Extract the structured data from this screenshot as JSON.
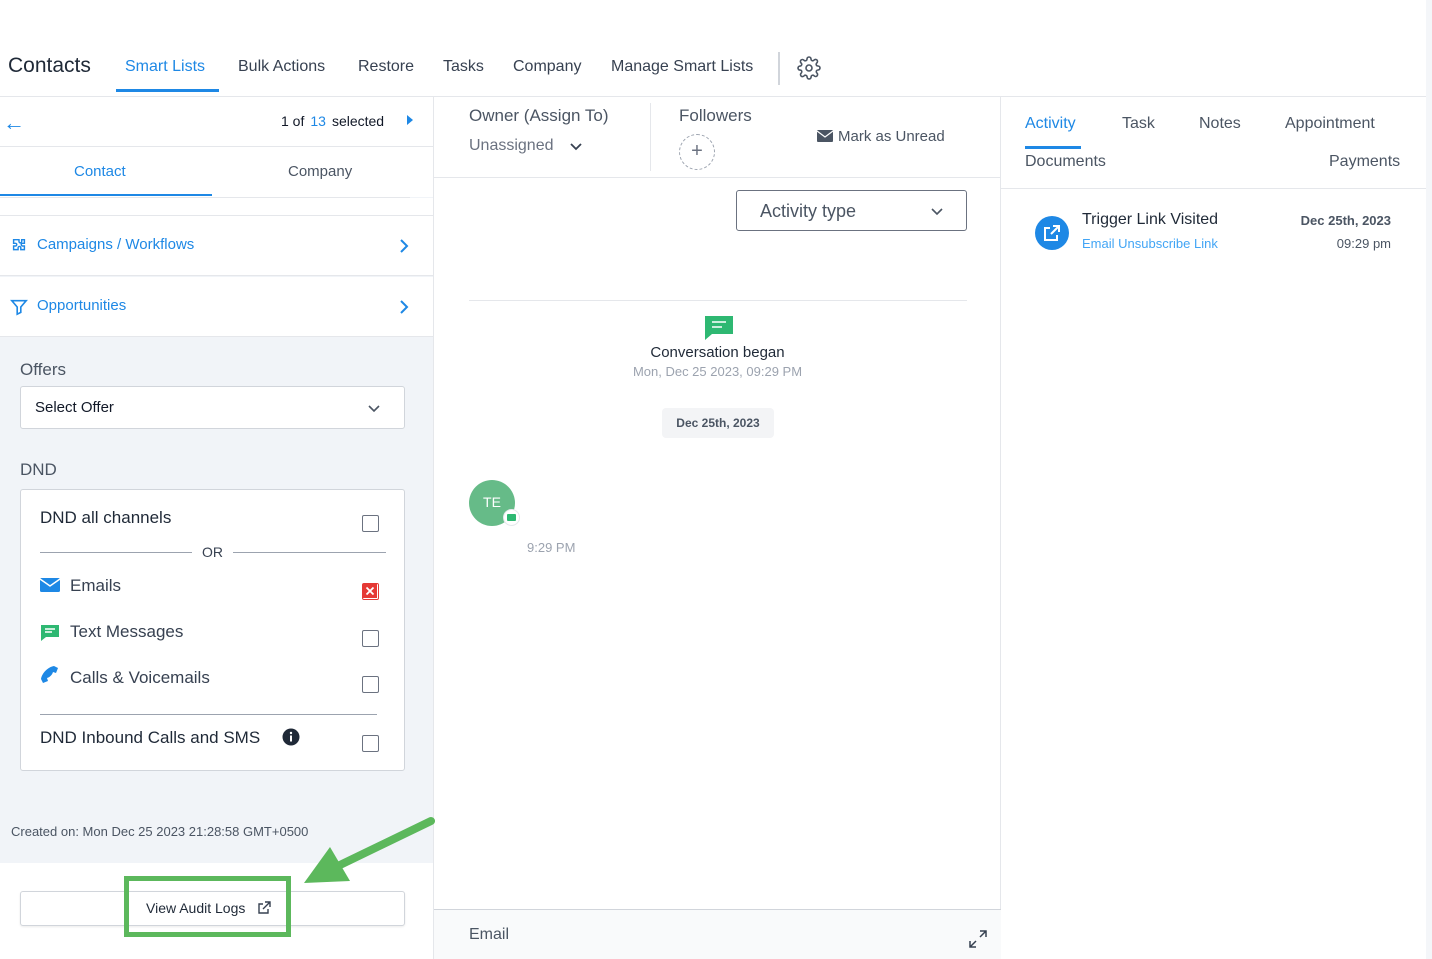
{
  "topnav": {
    "brand": "Contacts",
    "items": [
      {
        "label": "Smart Lists",
        "active": true
      },
      {
        "label": "Bulk Actions",
        "active": false
      },
      {
        "label": "Restore",
        "active": false
      },
      {
        "label": "Tasks",
        "active": false
      },
      {
        "label": "Company",
        "active": false
      },
      {
        "label": "Manage Smart Lists",
        "active": false
      }
    ]
  },
  "left": {
    "counter": {
      "prefix": "1 of",
      "total": "13",
      "suffix": "selected"
    },
    "tabs": {
      "contact": "Contact",
      "company": "Company"
    },
    "rows": {
      "campaigns": "Campaigns / Workflows",
      "opportunities": "Opportunities"
    },
    "offers": {
      "label": "Offers",
      "selected": "Select Offer"
    },
    "dnd": {
      "label": "DND",
      "all_channels": "DND all channels",
      "or_text": "OR",
      "channels": [
        {
          "label": "Emails",
          "checked": true
        },
        {
          "label": "Text Messages",
          "checked": false
        },
        {
          "label": "Calls & Voicemails",
          "checked": false
        }
      ],
      "inbound": "DND Inbound Calls and SMS"
    },
    "created": "Created on: Mon Dec 25 2023 21:28:58 GMT+0500",
    "audit_button": "View Audit Logs"
  },
  "mid": {
    "owner_label": "Owner (Assign To)",
    "owner_value": "Unassigned",
    "followers_label": "Followers",
    "mark_unread": "Mark as Unread",
    "activity_type": "Activity type",
    "conversation_title": "Conversation began",
    "conversation_time": "Mon, Dec 25 2023, 09:29 PM",
    "date_pill": "Dec 25th, 2023",
    "avatar_initials": "TE",
    "message_time": "9:29 PM",
    "compose_label": "Email"
  },
  "right": {
    "tabs": [
      "Activity",
      "Task",
      "Notes",
      "Appointment",
      "Documents",
      "Payments"
    ],
    "activity": {
      "title": "Trigger Link Visited",
      "subtitle": "Email Unsubscribe Link",
      "date": "Dec 25th, 2023",
      "time": "09:29 pm"
    }
  },
  "colors": {
    "accent": "#1e88e5",
    "highlight": "#5cb85c",
    "danger": "#e53935",
    "avatar": "#66bb88"
  }
}
